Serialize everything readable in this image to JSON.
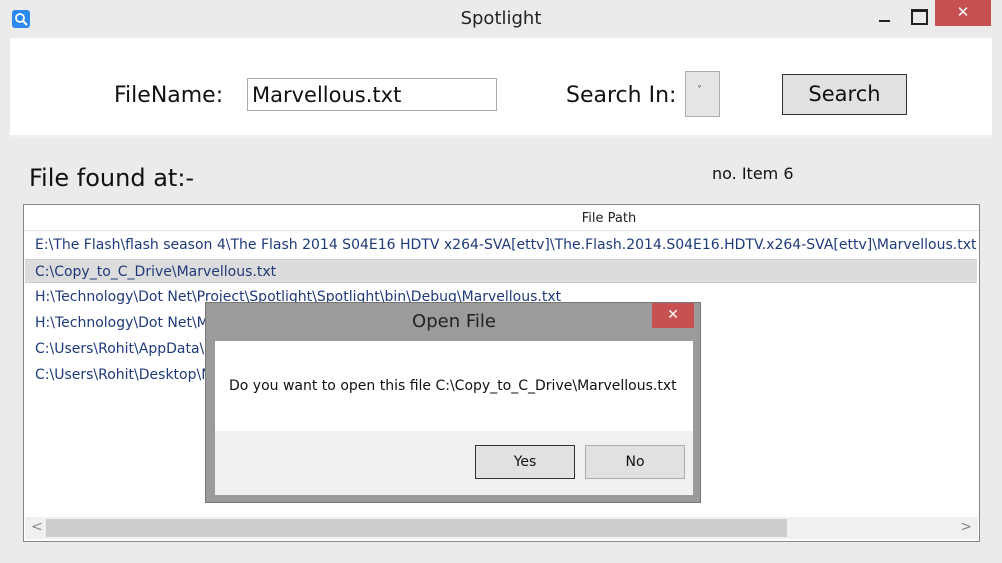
{
  "window": {
    "title": "Spotlight",
    "close_glyph": "✕"
  },
  "search": {
    "filename_label": "FileName:",
    "filename_value": "Marvellous.txt",
    "search_in_label": "Search In:",
    "search_in_chevron": "˅",
    "search_button": "Search"
  },
  "results": {
    "found_label": "File found at:-",
    "count_label": "no. Item 6",
    "column_header": "File Path",
    "rows": [
      "E:\\The Flash\\flash season 4\\The Flash 2014 S04E16 HDTV x264-SVA[ettv]\\The.Flash.2014.S04E16.HDTV.x264-SVA[ettv]\\Marvellous.txt",
      "C:\\Copy_to_C_Drive\\Marvellous.txt",
      "H:\\Technology\\Dot Net\\Project\\Spotlight\\Spotlight\\bin\\Debug\\Marvellous.txt",
      "H:\\Technology\\Dot Net\\M",
      "C:\\Users\\Rohit\\AppData\\R",
      "C:\\Users\\Rohit\\Desktop\\M"
    ],
    "scroll_left": "<",
    "scroll_right": ">"
  },
  "dialog": {
    "title": "Open File",
    "close_glyph": "✕",
    "message": "Do you want to open this file C:\\Copy_to_C_Drive\\Marvellous.txt",
    "yes_label": "Yes",
    "no_label": "No"
  },
  "colors": {
    "close_button": "#c75050",
    "row_text": "#1f3a7a",
    "selected_row": "#dcdcdc"
  }
}
